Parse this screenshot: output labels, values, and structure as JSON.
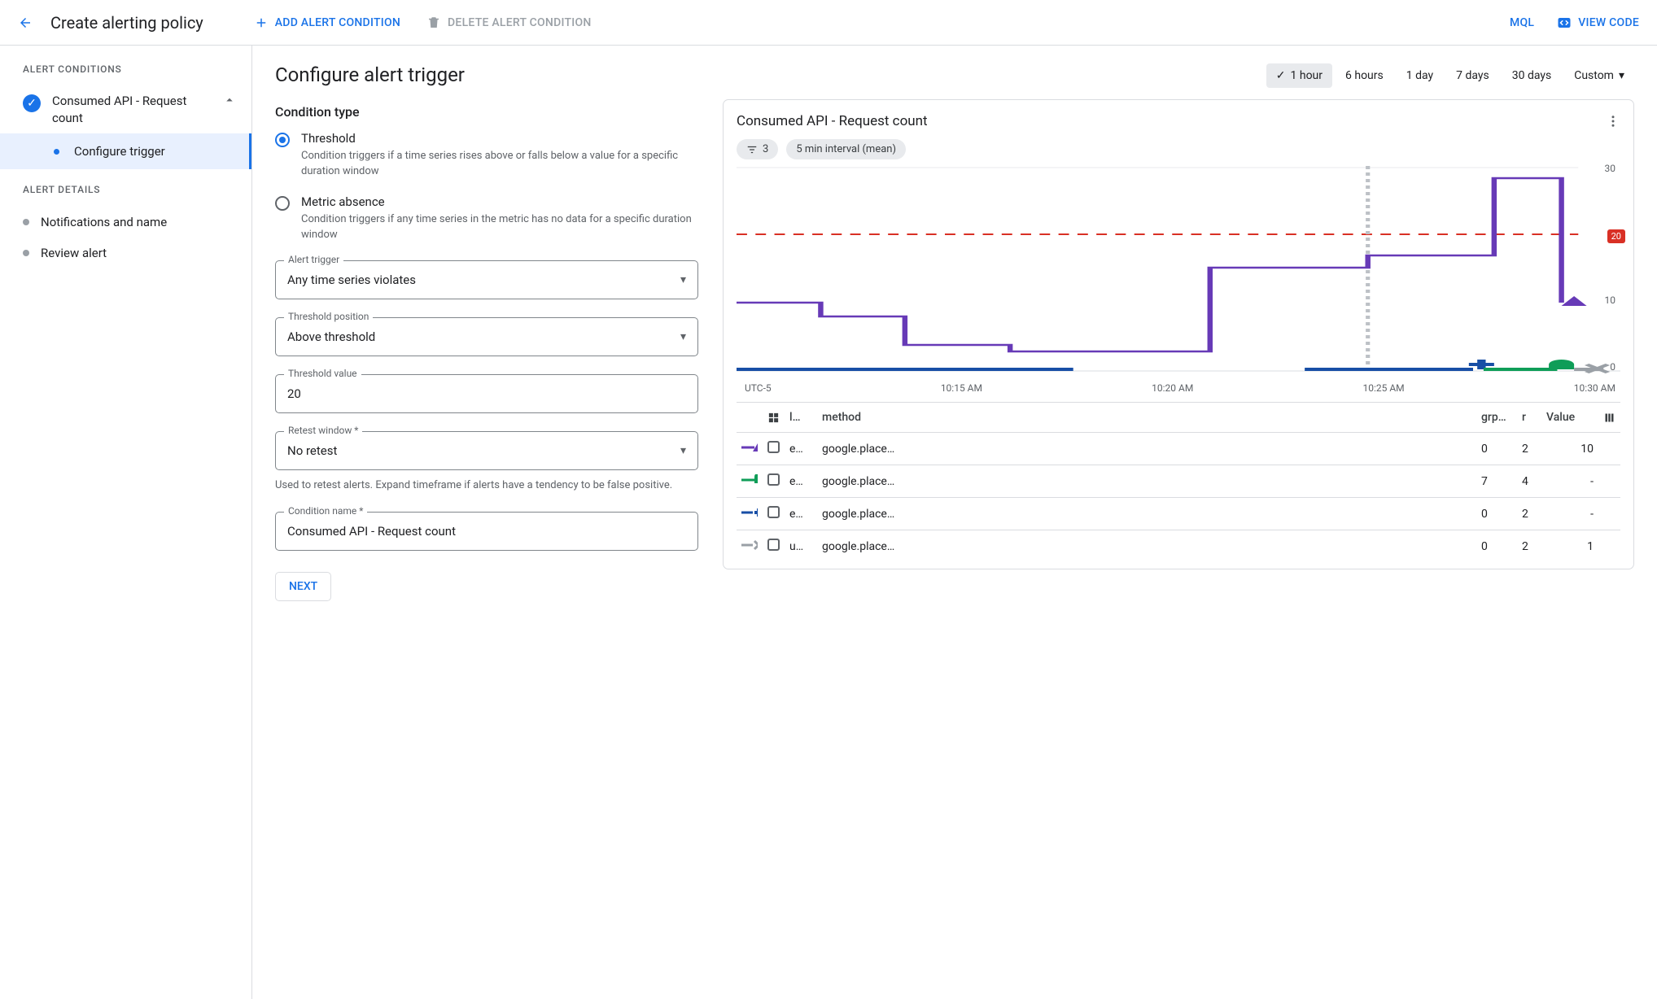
{
  "header": {
    "title": "Create alerting policy",
    "add_condition": "ADD ALERT CONDITION",
    "delete_condition": "DELETE ALERT CONDITION",
    "mql": "MQL",
    "view_code": "VIEW CODE"
  },
  "sidebar": {
    "conditions_hdr": "ALERT CONDITIONS",
    "condition_name": "Consumed API - Request count",
    "configure_trigger": "Configure trigger",
    "details_hdr": "ALERT DETAILS",
    "notifications": "Notifications and name",
    "review": "Review alert"
  },
  "form": {
    "title": "Configure alert trigger",
    "condition_type_hdr": "Condition type",
    "threshold_title": "Threshold",
    "threshold_desc": "Condition triggers if a time series rises above or falls below a value for a specific duration window",
    "absence_title": "Metric absence",
    "absence_desc": "Condition triggers if any time series in the metric has no data for a specific duration window",
    "alert_trigger_label": "Alert trigger",
    "alert_trigger_value": "Any time series violates",
    "threshold_position_label": "Threshold position",
    "threshold_position_value": "Above threshold",
    "threshold_value_label": "Threshold value",
    "threshold_value": "20",
    "retest_label": "Retest window *",
    "retest_value": "No retest",
    "retest_helper": "Used to retest alerts. Expand timeframe if alerts have a tendency to be false positive.",
    "cond_name_label": "Condition name *",
    "cond_name_value": "Consumed API - Request count",
    "next": "NEXT"
  },
  "time_range": {
    "options": [
      "1 hour",
      "6 hours",
      "1 day",
      "7 days",
      "30 days",
      "Custom"
    ],
    "active": "1 hour"
  },
  "chart": {
    "title": "Consumed API - Request count",
    "filter_count": "3",
    "interval_chip": "5 min interval (mean)",
    "timezone": "UTC-5",
    "xticks": [
      "10:15 AM",
      "10:20 AM",
      "10:25 AM",
      "10:30 AM"
    ],
    "yticks": [
      "30",
      "20",
      "10",
      "0"
    ],
    "threshold_badge": "20"
  },
  "table": {
    "headers": {
      "loc": "l…",
      "method": "method",
      "grp": "grp…",
      "r": "r",
      "value": "Value"
    },
    "rows": [
      {
        "mark": "purple-tri",
        "loc": "e…",
        "method": "google.place…",
        "grp": "0",
        "r": "2",
        "value": "10"
      },
      {
        "mark": "green-bar",
        "loc": "e…",
        "method": "google.place…",
        "grp": "7",
        "r": "4",
        "value": "-"
      },
      {
        "mark": "blue-plus",
        "loc": "e…",
        "method": "google.place…",
        "grp": "0",
        "r": "2",
        "value": "-"
      },
      {
        "mark": "grey-x",
        "loc": "u…",
        "method": "google.place…",
        "grp": "0",
        "r": "2",
        "value": "1"
      }
    ]
  },
  "chart_data": {
    "type": "line",
    "title": "Consumed API - Request count",
    "xlabel": "",
    "ylabel": "",
    "ylim": [
      0,
      30
    ],
    "x": [
      "10:10",
      "10:12",
      "10:14",
      "10:16",
      "10:18",
      "10:20",
      "10:22",
      "10:24",
      "10:25",
      "10:26",
      "10:28",
      "10:30",
      "10:31"
    ],
    "threshold": 20,
    "series": [
      {
        "name": "purple",
        "color": "#673ab7",
        "values": [
          10,
          10,
          8,
          8,
          4,
          3,
          3,
          15,
          15,
          17,
          17,
          28,
          10
        ]
      },
      {
        "name": "blue",
        "color": "#174ea6",
        "values": [
          0,
          0,
          0,
          0,
          0,
          0,
          0,
          null,
          null,
          0,
          0,
          0,
          0
        ]
      },
      {
        "name": "green",
        "color": "#0f9d58",
        "values": [
          null,
          null,
          null,
          null,
          null,
          null,
          null,
          null,
          null,
          0,
          0,
          0,
          null
        ]
      },
      {
        "name": "grey",
        "color": "#9aa0a6",
        "values": [
          null,
          null,
          null,
          null,
          null,
          null,
          null,
          null,
          null,
          null,
          null,
          0,
          0
        ]
      }
    ],
    "xticks": [
      "10:15 AM",
      "10:20 AM",
      "10:25 AM",
      "10:30 AM"
    ]
  }
}
